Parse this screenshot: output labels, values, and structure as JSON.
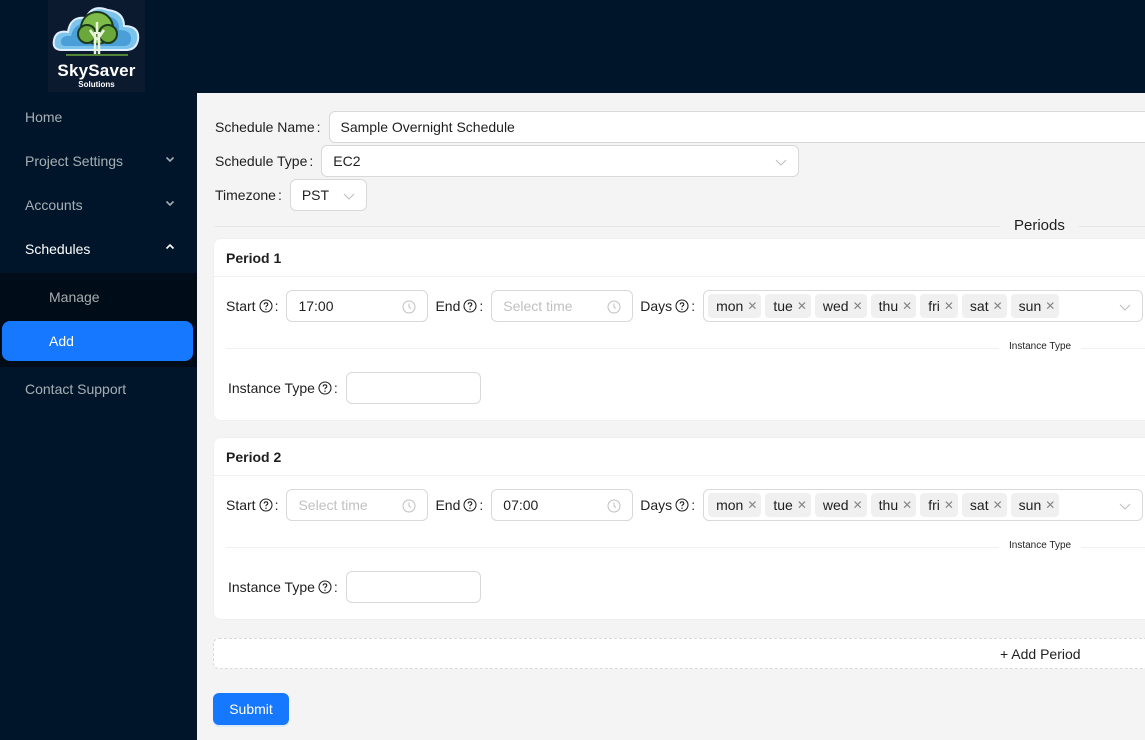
{
  "brand": {
    "name": "SkySaver",
    "subtitle": "Solutions"
  },
  "sidebar": {
    "items": [
      {
        "label": "Home",
        "icon": null
      },
      {
        "label": "Project Settings",
        "icon": "chevron-down-icon"
      },
      {
        "label": "Accounts",
        "icon": "chevron-down-icon"
      },
      {
        "label": "Schedules",
        "icon": "chevron-up-icon",
        "open": true
      },
      {
        "label": "Contact Support",
        "icon": null
      }
    ],
    "schedules_sub": [
      {
        "label": "Manage",
        "selected": false
      },
      {
        "label": "Add",
        "selected": true
      }
    ]
  },
  "form": {
    "schedule_name": {
      "label": "Schedule Name",
      "value": "Sample Overnight Schedule"
    },
    "schedule_type": {
      "label": "Schedule Type",
      "value": "EC2"
    },
    "timezone": {
      "label": "Timezone",
      "value": "PST"
    },
    "periods_title": "Periods",
    "periods": [
      {
        "title": "Period 1",
        "start": {
          "label": "Start",
          "value": "17:00",
          "placeholder": "Select time"
        },
        "end": {
          "label": "End",
          "value": "",
          "placeholder": "Select time"
        },
        "days": {
          "label": "Days",
          "selected": [
            "mon",
            "tue",
            "wed",
            "thu",
            "fri",
            "sat",
            "sun"
          ]
        },
        "instance_type_divider": "Instance Type",
        "instance_type": {
          "label": "Instance Type",
          "value": ""
        }
      },
      {
        "title": "Period 2",
        "start": {
          "label": "Start",
          "value": "",
          "placeholder": "Select time"
        },
        "end": {
          "label": "End",
          "value": "07:00",
          "placeholder": "Select time"
        },
        "days": {
          "label": "Days",
          "selected": [
            "mon",
            "tue",
            "wed",
            "thu",
            "fri",
            "sat",
            "sun"
          ]
        },
        "instance_type_divider": "Instance Type",
        "instance_type": {
          "label": "Instance Type",
          "value": ""
        }
      }
    ],
    "add_period_label": "+ Add Period",
    "submit_label": "Submit"
  },
  "colors": {
    "primary": "#1677ff",
    "sider": "#001529",
    "submenu": "#000c17",
    "content_bg": "#f4f4f4"
  }
}
